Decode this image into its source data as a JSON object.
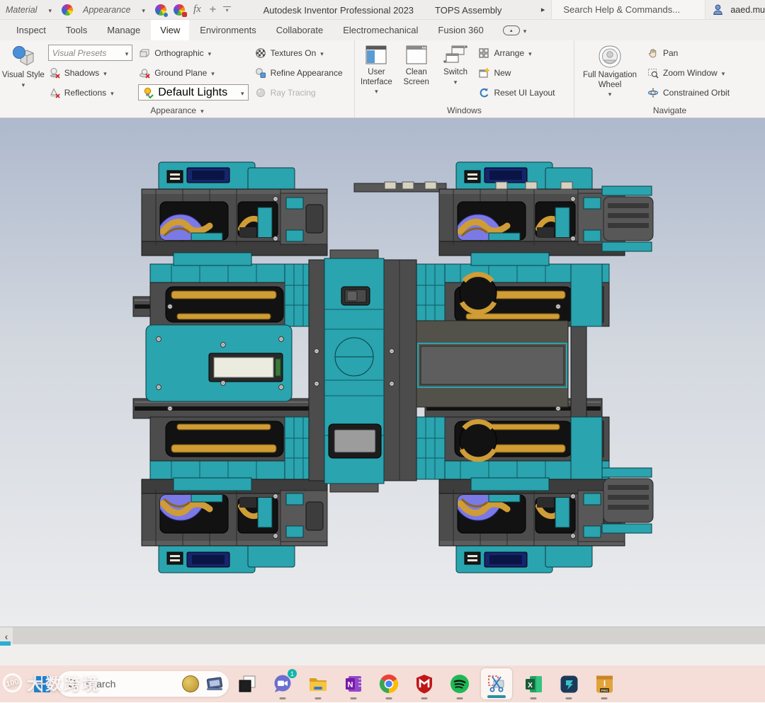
{
  "titlebar": {
    "material_label": "Material",
    "appearance_label": "Appearance",
    "fx_label": "fx",
    "app_title": "Autodesk Inventor Professional 2023",
    "doc_title": "TOPS Assembly",
    "search_text": "Search Help & Commands...",
    "user_name": "aaed.mu"
  },
  "tabs": [
    {
      "label": "Inspect"
    },
    {
      "label": "Tools"
    },
    {
      "label": "Manage"
    },
    {
      "label": "View"
    },
    {
      "label": "Environments"
    },
    {
      "label": "Collaborate"
    },
    {
      "label": "Electromechanical"
    },
    {
      "label": "Fusion 360"
    }
  ],
  "panels": {
    "appearance": {
      "visual_style": "Visual Style",
      "visual_presets": "Visual Presets",
      "shadows": "Shadows",
      "reflections": "Reflections",
      "orthographic": "Orthographic",
      "ground_plane": "Ground Plane",
      "default_lights": "Default Lights",
      "textures_on": "Textures On",
      "refine_appearance": "Refine Appearance",
      "ray_tracing": "Ray Tracing",
      "label": "Appearance"
    },
    "windows": {
      "user_interface": "User Interface",
      "clean_screen": "Clean Screen",
      "switch": "Switch",
      "arrange": "Arrange",
      "new": "New",
      "reset_ui": "Reset UI Layout",
      "label": "Windows"
    },
    "navigate": {
      "wheel": "Full Navigation Wheel",
      "pan": "Pan",
      "zoom_window": "Zoom Window",
      "constrained_orbit": "Constrained Orbit",
      "label": "Navigate"
    }
  },
  "viewport_model": {
    "description": "TOPS quadruped robot assembly, orthographic top view",
    "colors": {
      "teal": "#2aa4af",
      "frame_gray": "#4c4c4c",
      "motor_gold": "#cf9c35",
      "disc_purple": "#7b79e6",
      "background_top": "#aeb9cd",
      "background_bottom": "#ebecee"
    }
  },
  "taskbar": {
    "search_placeholder": "Search",
    "chat_badge": "1"
  },
  "watermark": {
    "logo": "100",
    "text": "大数跨境"
  }
}
